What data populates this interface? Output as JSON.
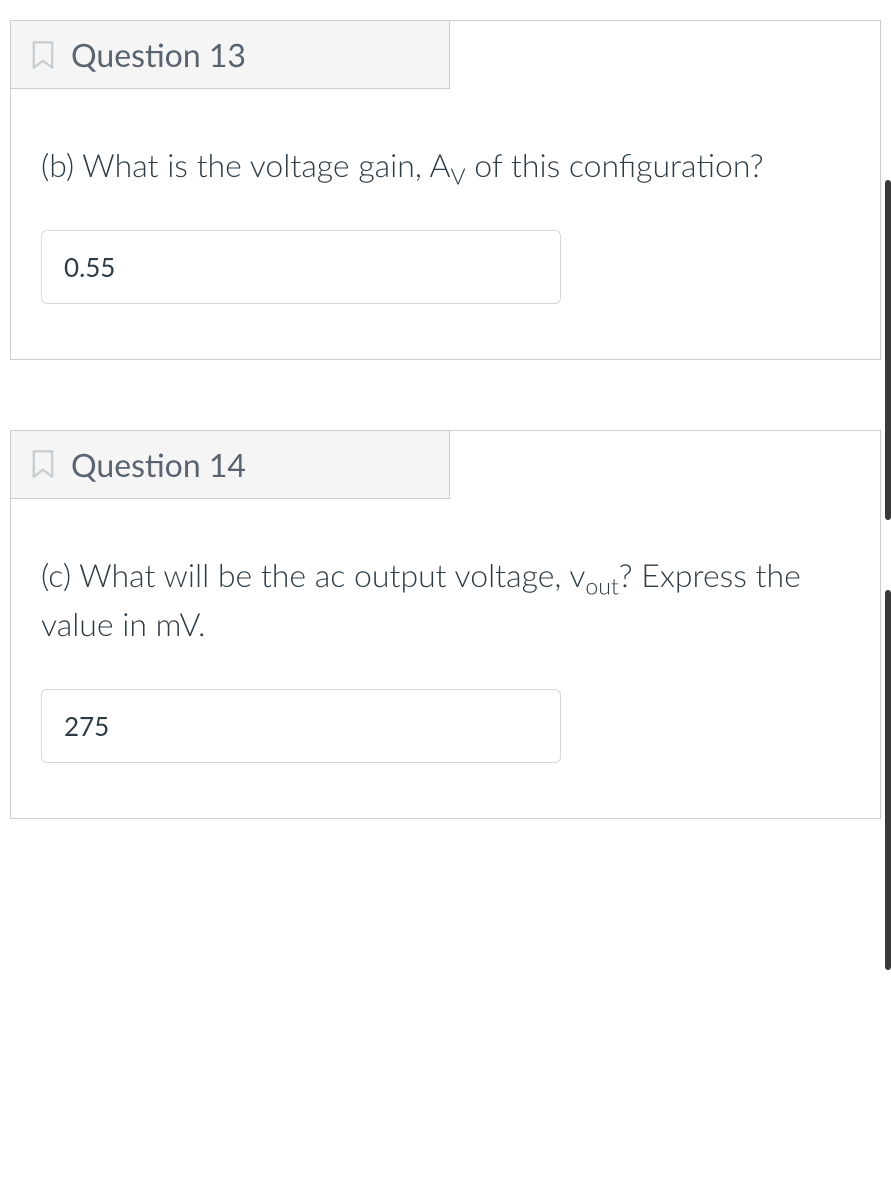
{
  "questions": [
    {
      "number": "Question 13",
      "prompt_prefix": "(b) What is the voltage gain, A",
      "prompt_sub": "V",
      "prompt_suffix": " of this configuration?",
      "answer_value": "0.55"
    },
    {
      "number": "Question 14",
      "prompt_prefix": "(c) What will be the ac output voltage, v",
      "prompt_sub": "out",
      "prompt_suffix": "? Express the value in mV.",
      "answer_value": "275"
    }
  ]
}
